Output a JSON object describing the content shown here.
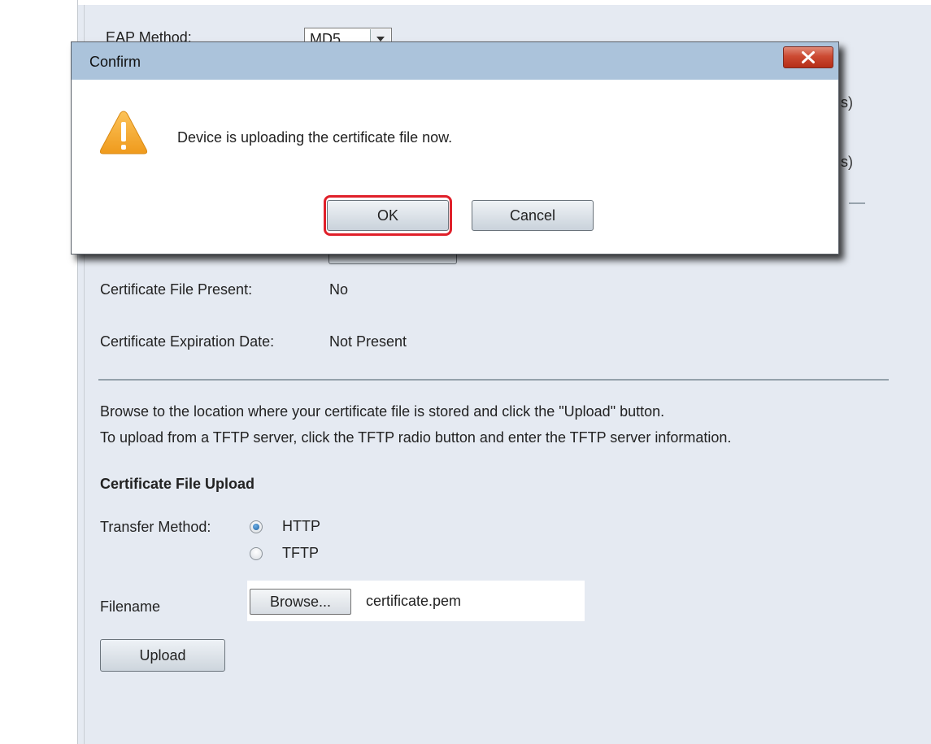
{
  "background_form": {
    "eap_method_label": "EAP Method:",
    "eap_method_value": "MD5",
    "partial_suffix_1": "s)",
    "partial_suffix_2": "s)",
    "certificate_file_present_label": "Certificate File Present:",
    "certificate_file_present_value": "No",
    "certificate_expiration_label": "Certificate Expiration Date:",
    "certificate_expiration_value": "Not Present",
    "instructions": [
      "Browse to the location where your certificate file is stored and click the \"Upload\" button.",
      "To upload from a TFTP server, click the TFTP radio button and enter the TFTP server information."
    ],
    "section_heading": "Certificate File Upload",
    "transfer_method_label": "Transfer Method:",
    "transfer_options": [
      {
        "label": "HTTP",
        "selected": true
      },
      {
        "label": "TFTP",
        "selected": false
      }
    ],
    "filename_label": "Filename",
    "browse_label": "Browse...",
    "selected_file": "certificate.pem",
    "upload_label": "Upload"
  },
  "dialog": {
    "title": "Confirm",
    "message": "Device is uploading the certificate file now.",
    "ok_label": "OK",
    "cancel_label": "Cancel",
    "icon": "warning-icon"
  },
  "colors": {
    "page_background": "#e5eaf2",
    "dialog_titlebar": "#abc3db",
    "close_button": "#cc4a32",
    "highlight": "#e0202a",
    "warning": "#f6a623"
  }
}
